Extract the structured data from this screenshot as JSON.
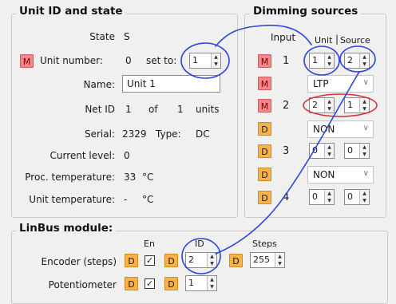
{
  "unit_group": {
    "title": "Unit ID and state",
    "state_label": "State",
    "state_value": "S",
    "m_label": "M",
    "unit_number_label": "Unit number:",
    "unit_number_value": "0",
    "set_to_label": "set to:",
    "set_to_value": "1",
    "name_label": "Name:",
    "name_value": "Unit 1",
    "netid_label": "Net ID",
    "netid_value": "1",
    "of_label": "of",
    "units_value": "1",
    "units_label": "units",
    "serial_label": "Serial:",
    "serial_value": "2329",
    "type_label": "Type:",
    "type_value": "DC",
    "current_level_label": "Current level:",
    "current_level_value": "0",
    "proc_temp_label": "Proc. temperature:",
    "proc_temp_value": "33",
    "proc_temp_unit": "°C",
    "unit_temp_label": "Unit temperature:",
    "unit_temp_value": "-",
    "unit_temp_unit": "°C"
  },
  "dimming": {
    "title": "Dimming sources",
    "input_header": "Input",
    "unit_header": "Unit",
    "source_header": "Source",
    "rows": [
      {
        "badge": "M",
        "input": "1",
        "unit": "1",
        "source": "2"
      },
      {
        "badge": "M",
        "mode": "LTP"
      },
      {
        "badge": "M",
        "input": "2",
        "unit": "2",
        "source": "1"
      },
      {
        "badge": "D",
        "mode": "NON"
      },
      {
        "badge": "D",
        "input": "3",
        "unit": "0",
        "source": "0"
      },
      {
        "badge": "D",
        "mode": "NON"
      },
      {
        "badge": "D",
        "input": "4",
        "unit": "0",
        "source": "0"
      }
    ]
  },
  "linbus": {
    "title": "LinBus module:",
    "en_header": "En",
    "id_header": "ID",
    "steps_header": "Steps",
    "badge_d": "D",
    "encoder_label": "Encoder (steps)",
    "encoder_id": "2",
    "encoder_steps": "255",
    "pot_label": "Potentiometer",
    "pot_id": "1"
  },
  "colors": {
    "m_button": "#f4858a",
    "d_button": "#f7b24a",
    "ink_blue": "#2c46d8",
    "ink_red": "#d8323a"
  }
}
